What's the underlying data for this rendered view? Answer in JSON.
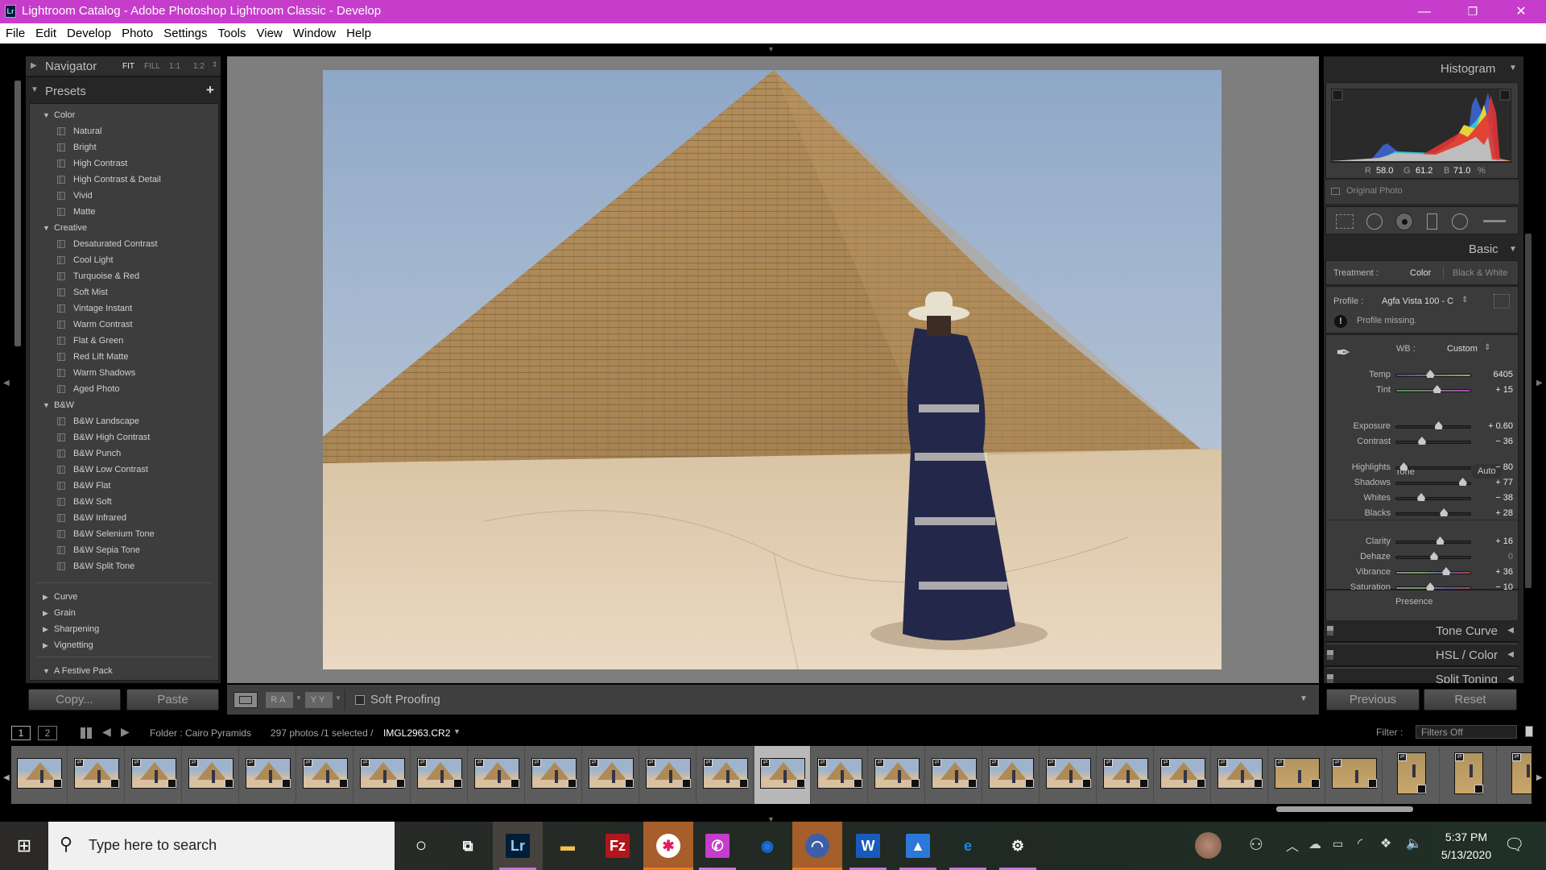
{
  "window": {
    "title": "Lightroom Catalog - Adobe Photoshop Lightroom Classic - Develop",
    "app_badge": "Lr",
    "minimize": "—",
    "restore": "❐",
    "close": "✕"
  },
  "menu": [
    "File",
    "Edit",
    "Develop",
    "Photo",
    "Settings",
    "Tools",
    "View",
    "Window",
    "Help"
  ],
  "navigator": {
    "title": "Navigator",
    "zoom_options": [
      "FIT",
      "FILL",
      "1:1",
      "1:2"
    ],
    "active": "FIT"
  },
  "presets": {
    "title": "Presets",
    "add_icon": "+",
    "groups": [
      {
        "name": "Color",
        "expanded": true,
        "items": [
          "Natural",
          "Bright",
          "High Contrast",
          "High Contrast & Detail",
          "Vivid",
          "Matte"
        ]
      },
      {
        "name": "Creative",
        "expanded": true,
        "items": [
          "Desaturated Contrast",
          "Cool Light",
          "Turquoise & Red",
          "Soft Mist",
          "Vintage Instant",
          "Warm Contrast",
          "Flat & Green",
          "Red Lift Matte",
          "Warm Shadows",
          "Aged Photo"
        ]
      },
      {
        "name": "B&W",
        "expanded": true,
        "items": [
          "B&W Landscape",
          "B&W High Contrast",
          "B&W Punch",
          "B&W Low Contrast",
          "B&W Flat",
          "B&W Soft",
          "B&W Infrared",
          "B&W Selenium Tone",
          "B&W Sepia Tone",
          "B&W Split Tone"
        ]
      },
      {
        "name": "Curve",
        "expanded": false,
        "items": []
      },
      {
        "name": "Grain",
        "expanded": false,
        "items": []
      },
      {
        "name": "Sharpening",
        "expanded": false,
        "items": []
      },
      {
        "name": "Vignetting",
        "expanded": false,
        "items": []
      },
      {
        "name": "A Festive Pack",
        "expanded": true,
        "items": []
      }
    ],
    "copy_label": "Copy...",
    "paste_label": "Paste"
  },
  "toolbar": {
    "view_modes": [
      "loupe",
      "RA",
      "YY"
    ],
    "soft_proofing_label": "Soft Proofing",
    "soft_proofing_checked": false
  },
  "histogram": {
    "title": "Histogram",
    "r_label": "R",
    "r": "58.0",
    "g_label": "G",
    "g": "61.2",
    "b_label": "B",
    "b": "71.0",
    "pct": "%",
    "original_photo": "Original Photo"
  },
  "tools": [
    "crop-overlay",
    "spot-removal",
    "red-eye",
    "graduated-filter",
    "radial-filter",
    "adjustment-brush"
  ],
  "basic": {
    "title": "Basic",
    "treatment_label": "Treatment :",
    "treatment_color": "Color",
    "treatment_bw": "Black & White",
    "profile_label": "Profile :",
    "profile_value": "Agfa Vista 100 - C",
    "profile_warning": "Profile missing.",
    "wb_label": "WB :",
    "wb_value": "Custom",
    "tone_label": "Tone",
    "auto_label": "Auto",
    "presence_label": "Presence",
    "sliders": [
      {
        "name": "Temp",
        "value": "6405",
        "pos": 0.45,
        "track": "temp",
        "section": "wb"
      },
      {
        "name": "Tint",
        "value": "+ 15",
        "pos": 0.54,
        "track": "tint",
        "section": "wb"
      },
      {
        "name": "Exposure",
        "value": "+ 0.60",
        "pos": 0.56,
        "track": "plain",
        "section": "tone1"
      },
      {
        "name": "Contrast",
        "value": "− 36",
        "pos": 0.34,
        "track": "plain",
        "section": "tone1"
      },
      {
        "name": "Highlights",
        "value": "− 80",
        "pos": 0.1,
        "track": "plain",
        "section": "tone2"
      },
      {
        "name": "Shadows",
        "value": "+ 77",
        "pos": 0.88,
        "track": "plain",
        "section": "tone2"
      },
      {
        "name": "Whites",
        "value": "− 38",
        "pos": 0.33,
        "track": "plain",
        "section": "tone2"
      },
      {
        "name": "Blacks",
        "value": "+ 28",
        "pos": 0.63,
        "track": "plain",
        "section": "tone2"
      },
      {
        "name": "Clarity",
        "value": "+ 16",
        "pos": 0.58,
        "track": "plain",
        "section": "presence"
      },
      {
        "name": "Dehaze",
        "value": "0",
        "pos": 0.5,
        "track": "plain",
        "section": "presence"
      },
      {
        "name": "Vibrance",
        "value": "+ 36",
        "pos": 0.66,
        "track": "vib",
        "section": "presence"
      },
      {
        "name": "Saturation",
        "value": "− 10",
        "pos": 0.45,
        "track": "vib",
        "section": "presence"
      }
    ]
  },
  "collapsed_panels": [
    {
      "title": "Tone Curve"
    },
    {
      "title": "HSL / Color"
    },
    {
      "title": "Split Toning"
    }
  ],
  "previous_label": "Previous",
  "reset_label": "Reset",
  "filmstrip": {
    "screen1": "1",
    "screen2": "2",
    "folder": "Folder : Cairo Pyramids",
    "count": "297 photos /1 selected /",
    "filename": "IMGL2963.CR2",
    "filter_label": "Filter :",
    "filter_value": "Filters Off",
    "thumb_count": 27,
    "selected_index": 13
  },
  "taskbar": {
    "search_placeholder": "Type here to search",
    "apps": [
      "cortana",
      "task-view",
      "lightroom",
      "file-explorer",
      "filezilla",
      "slack",
      "whatsapp",
      "chrome",
      "nordvpn",
      "word",
      "photos",
      "edge",
      "settings"
    ],
    "time": "5:37 PM",
    "date": "5/13/2020"
  }
}
